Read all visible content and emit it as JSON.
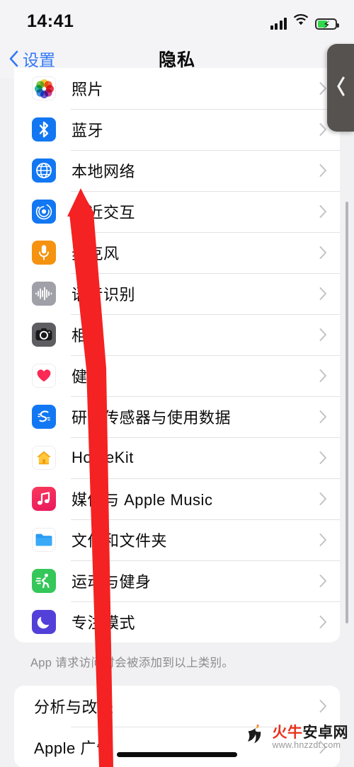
{
  "status_bar": {
    "time": "14:41",
    "signal_icon": "cellular-bars-icon",
    "wifi_icon": "wifi-icon",
    "battery_icon": "battery-charging-icon",
    "battery_level_percent": 40
  },
  "nav_bar": {
    "back_label": "设置",
    "back_icon": "chevron-left-icon",
    "title": "隐私"
  },
  "float_back": {
    "icon": "chevron-left-icon"
  },
  "main_list": {
    "rows": [
      {
        "label": "照片",
        "icon": "photos-icon",
        "style": "white",
        "chevron": "chevron-right-icon"
      },
      {
        "label": "蓝牙",
        "icon": "bluetooth-icon",
        "style": "blue",
        "chevron": "chevron-right-icon"
      },
      {
        "label": "本地网络",
        "icon": "globe-icon",
        "style": "blue",
        "chevron": "chevron-right-icon"
      },
      {
        "label": "附近交互",
        "icon": "nearby-radar-icon",
        "style": "blue",
        "chevron": "chevron-right-icon"
      },
      {
        "label": "麦克风",
        "icon": "microphone-icon",
        "style": "orange",
        "chevron": "chevron-right-icon"
      },
      {
        "label": "语音识别",
        "icon": "waveform-icon",
        "style": "gray",
        "chevron": "chevron-right-icon"
      },
      {
        "label": "相机",
        "icon": "camera-icon",
        "style": "dkgray",
        "chevron": "chevron-right-icon"
      },
      {
        "label": "健康",
        "icon": "heart-icon",
        "style": "white",
        "chevron": "chevron-right-icon"
      },
      {
        "label": "研究传感器与使用数据",
        "icon": "research-sensor-icon",
        "style": "blue",
        "chevron": "chevron-right-icon"
      },
      {
        "label": "HomeKit",
        "icon": "home-icon",
        "style": "white",
        "chevron": "chevron-right-icon"
      },
      {
        "label": "媒体与 Apple Music",
        "icon": "music-note-icon",
        "style": "pink",
        "chevron": "chevron-right-icon"
      },
      {
        "label": "文件和文件夹",
        "icon": "folder-icon",
        "style": "white",
        "chevron": "chevron-right-icon"
      },
      {
        "label": "运动与健身",
        "icon": "fitness-runner-icon",
        "style": "green",
        "chevron": "chevron-right-icon"
      },
      {
        "label": "专注模式",
        "icon": "moon-icon",
        "style": "purple",
        "chevron": "chevron-right-icon"
      }
    ],
    "footnote": "App 请求访问时会被添加到以上类别。"
  },
  "bottom_list": {
    "rows": [
      {
        "label": "分析与改进",
        "chevron": "chevron-right-icon"
      },
      {
        "label": "Apple 广告",
        "chevron": "chevron-right-icon"
      }
    ]
  },
  "annotation": {
    "type": "arrow",
    "color": "#f42222",
    "points_to": "本地网络"
  },
  "watermark": {
    "name_red": "火牛",
    "name_black": "安卓网",
    "url": "www.hnzzdt.com",
    "logo_icon": "bull-flame-logo-icon"
  },
  "colors": {
    "accent_blue": "#3478f6",
    "page_bg": "#f1f1f4",
    "card_bg": "#ffffff",
    "separator": "#e2e2e6",
    "footnote_text": "#8c8c90",
    "annotation_red": "#f42222"
  }
}
